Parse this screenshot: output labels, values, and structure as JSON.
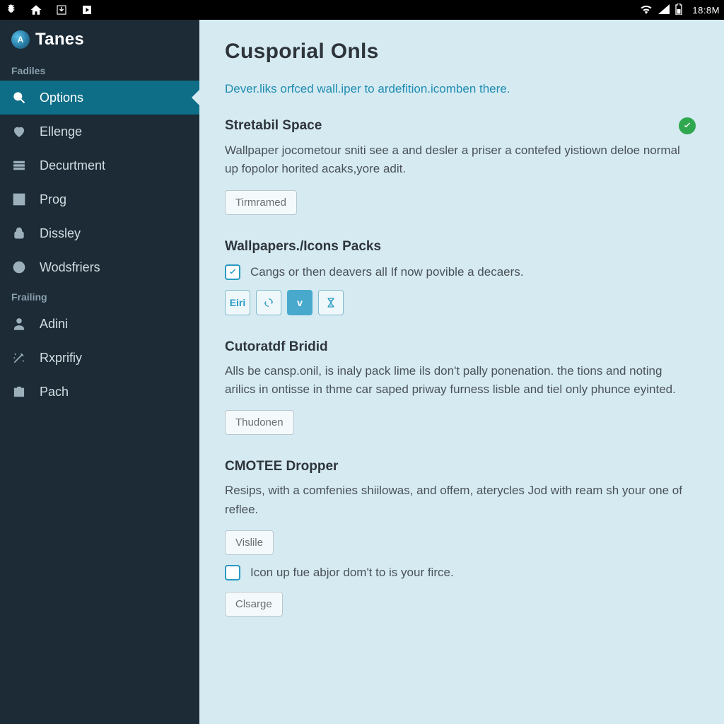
{
  "status": {
    "clock": "18:8M"
  },
  "brand": {
    "name": "Tanes"
  },
  "sidebar": {
    "group1_label": "Fadiles",
    "group2_label": "Frailing",
    "items": [
      {
        "label": "Options"
      },
      {
        "label": "Ellenge"
      },
      {
        "label": "Decurtment"
      },
      {
        "label": "Prog"
      },
      {
        "label": "Dissley"
      },
      {
        "label": "Wodsfriers"
      }
    ],
    "items2": [
      {
        "label": "Adini"
      },
      {
        "label": "Rxprifiy"
      },
      {
        "label": "Pach"
      }
    ]
  },
  "content": {
    "title": "Cusporial Onls",
    "intro": "Dever.liks orfced wall.iper to ardefition.icomben there.",
    "s1": {
      "heading": "Stretabil Space",
      "body": "Wallpaper jocometour sniti see a and desler a priser a contefed yistiown deloe normal up fopolor horited acaks,yore adit.",
      "button": "Tirmramed"
    },
    "s2": {
      "heading": "Wallpapers./Icons Packs",
      "check_label": "Cangs or then deavers all If now povible a decaers.",
      "chip1": "Eiri",
      "chip3": "v"
    },
    "s3": {
      "heading": "Cutoratdf Bridid",
      "body": "Alls be cansp.onil, is inaly pack lime ils don't pally ponenation. the tions and noting arilics in ontisse in thme car saped priway furness lisble and tiel only phunce eyinted.",
      "button": "Thudonen"
    },
    "s4": {
      "heading": "CMOTEE Dropper",
      "body": "Resips, with a comfenies shiilowas, and offem, aterycles Jod with ream sh your one of reflee.",
      "button1": "Vislile",
      "check_label": "Icon up fue abjor dom't to is your firce.",
      "button2": "Clsarge"
    }
  }
}
